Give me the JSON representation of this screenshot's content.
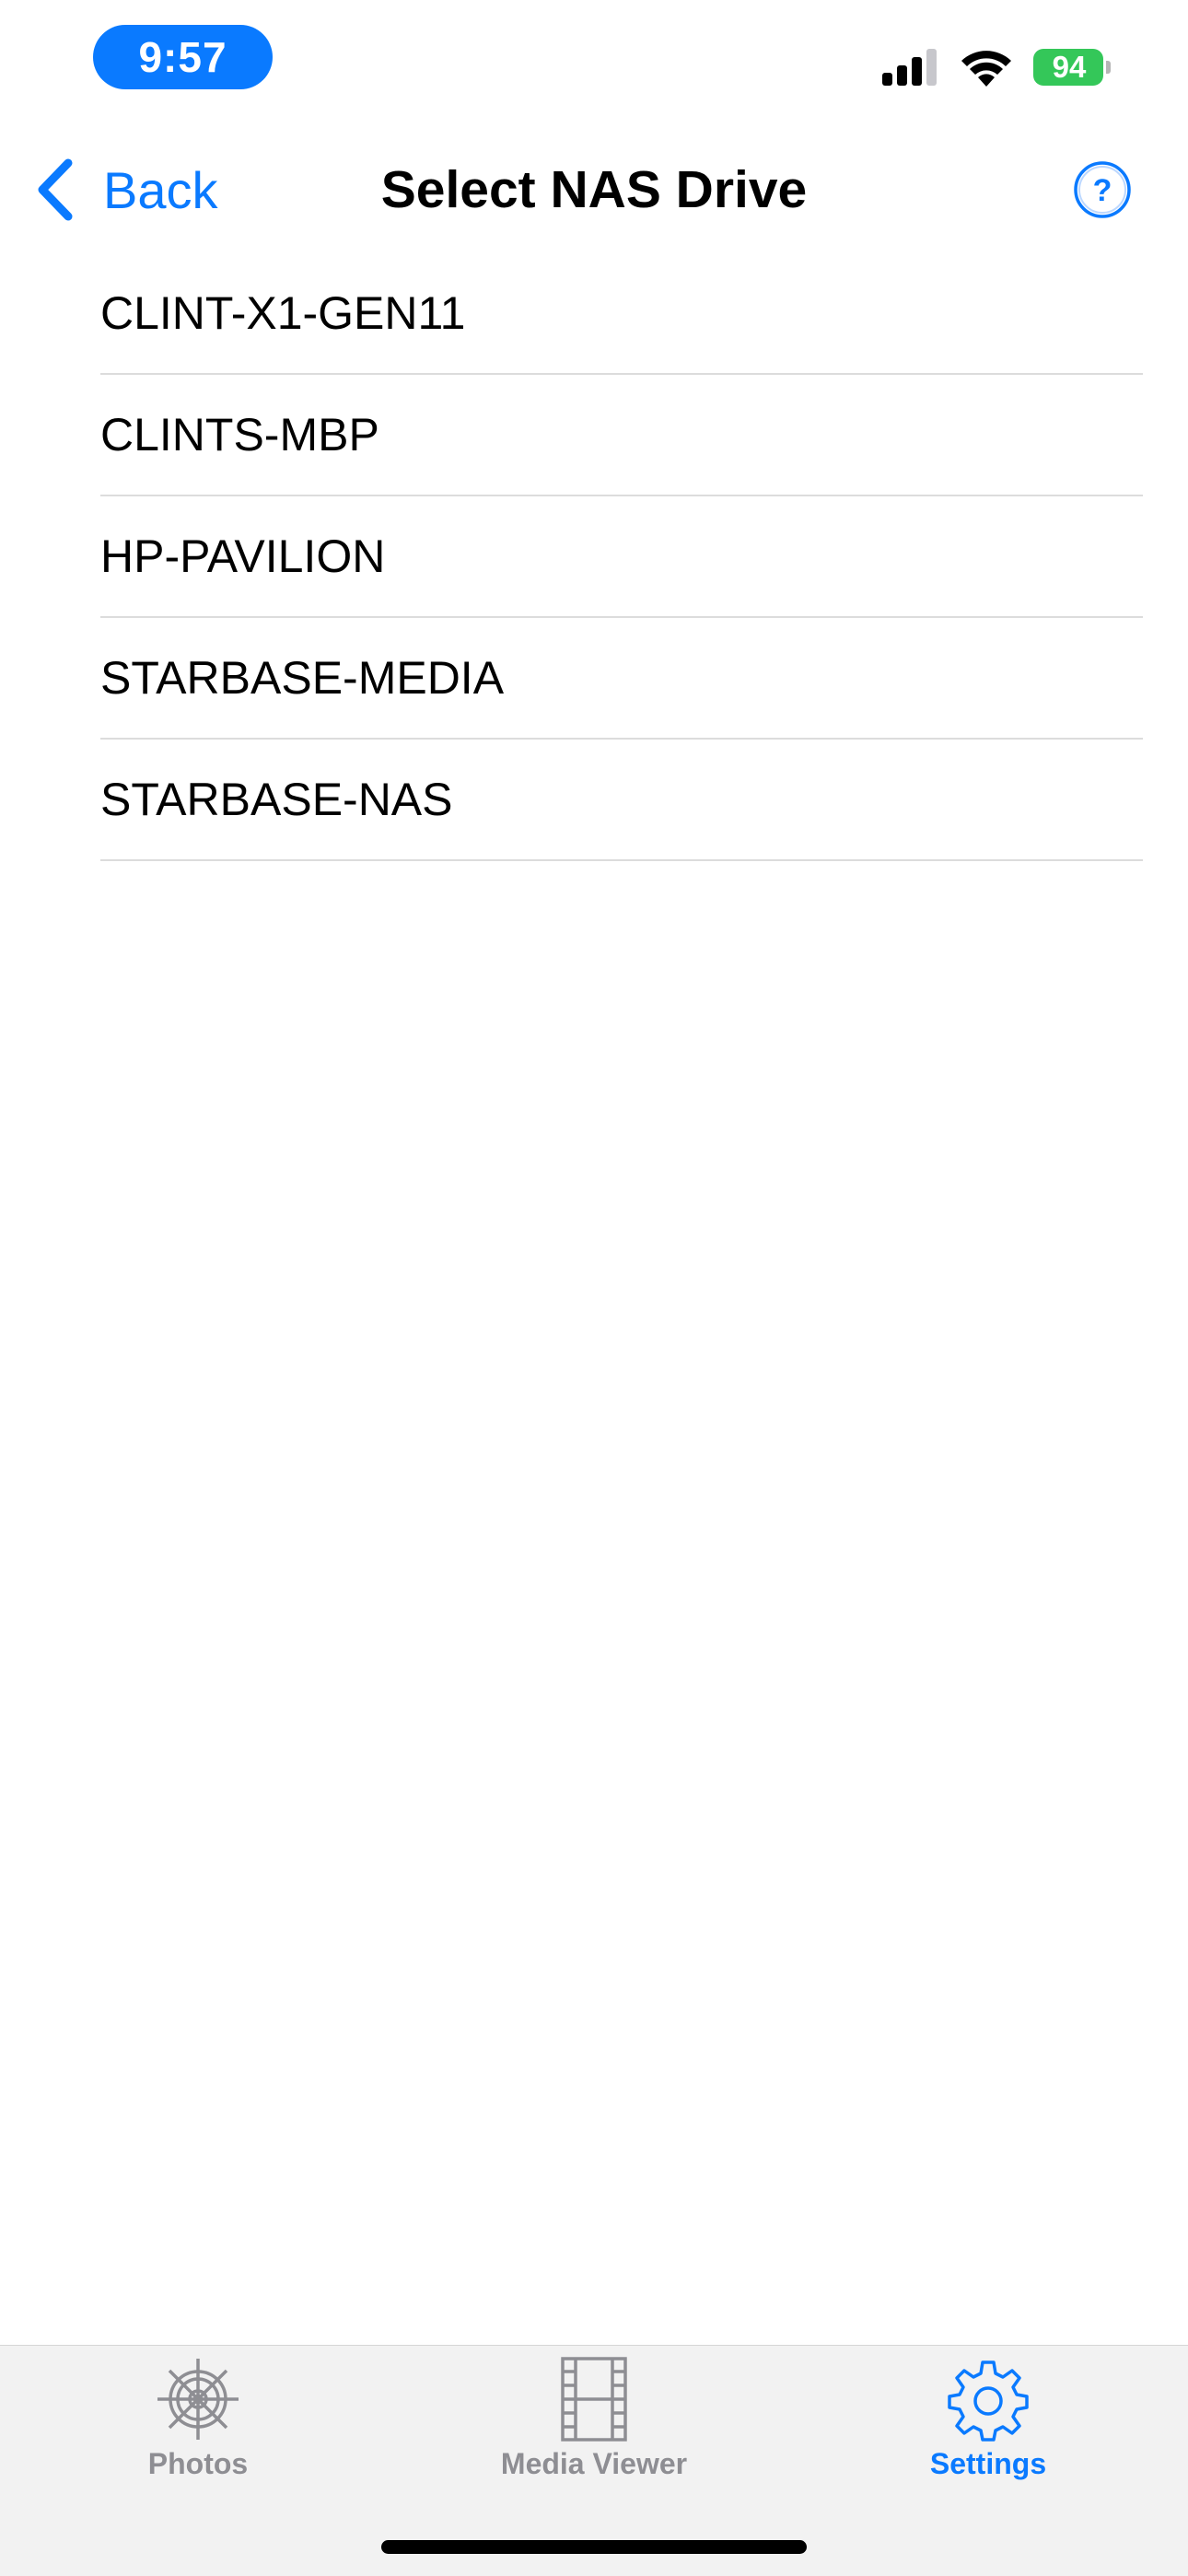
{
  "status_bar": {
    "time": "9:57",
    "battery_level": "94",
    "battery_color": "#34c759",
    "time_pill_color": "#0a7aff"
  },
  "nav_bar": {
    "back_label": "Back",
    "title": "Select NAS Drive",
    "help_icon": "question-circle-icon",
    "accent_color": "#0a7aff"
  },
  "drives": [
    {
      "label": "CLINT-X1-GEN11"
    },
    {
      "label": "CLINTS-MBP"
    },
    {
      "label": "HP-PAVILION"
    },
    {
      "label": "STARBASE-MEDIA"
    },
    {
      "label": "STARBASE-NAS"
    }
  ],
  "tab_bar": {
    "tabs": [
      {
        "label": "Photos",
        "icon": "ship-wheel-icon",
        "selected": false
      },
      {
        "label": "Media Viewer",
        "icon": "film-strip-icon",
        "selected": false
      },
      {
        "label": "Settings",
        "icon": "gear-icon",
        "selected": true
      }
    ],
    "active_color": "#0a7aff",
    "inactive_color": "#8e8e93"
  }
}
